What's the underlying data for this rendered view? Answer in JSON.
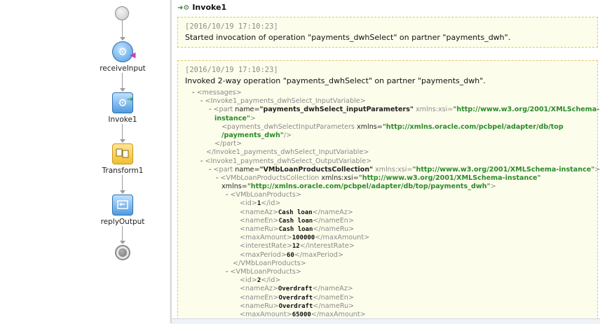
{
  "flow": {
    "nodes": [
      {
        "id": "start",
        "label": ""
      },
      {
        "id": "receive",
        "label": "receiveInput"
      },
      {
        "id": "invoke",
        "label": "Invoke1"
      },
      {
        "id": "transform",
        "label": "Transform1"
      },
      {
        "id": "reply",
        "label": "replyOutput"
      },
      {
        "id": "end",
        "label": ""
      }
    ]
  },
  "log": {
    "title": "Invoke1",
    "entry1": {
      "timestamp": "[2016/10/19 17:10:23]",
      "message": "Started invocation of operation \"payments_dwhSelect\" on partner \"payments_dwh\"."
    },
    "entry2": {
      "timestamp": "[2016/10/19 17:10:23]",
      "message": "Invoked 2-way operation \"payments_dwhSelect\" on partner \"payments_dwh\".",
      "xml": {
        "l1": "<messages>",
        "l2": "<Invoke1_payments_dwhSelect_InputVariable>",
        "l3_tag": "<part ",
        "l3_name_attr": "name=",
        "l3_name_val": "\"payments_dwhSelect_inputParameters\"",
        "l3_xmlns_attr": " xmlns:xsi=",
        "l3_xmlns_val": "\"http://www.w3.org/2001/XMLSchema-",
        "l4_val": "instance\"",
        "l4_close": ">",
        "l5_tag": "<payments_dwhSelectInputParameters ",
        "l5_attr": "xmlns=",
        "l5_val": "\"http://xmlns.oracle.com/pcbpel/adapter/db/top",
        "l6_val": "/payments_dwh\"",
        "l6_close": "/>",
        "l7": "</part>",
        "l8": "</Invoke1_payments_dwhSelect_InputVariable>",
        "l9": "<Invoke1_payments_dwhSelect_OutputVariable>",
        "l10_tag": "<part ",
        "l10_name_attr": "name=",
        "l10_name_val": "\"VMbLoanProductsCollection\"",
        "l10_xmlns_attr": " xmlns:xsi=",
        "l10_xmlns_val": "\"http://www.w3.org/2001/XMLSchema-instance\"",
        "l10_close": ">",
        "l11_tag": "<VMbLoanProductsCollection ",
        "l11_attr": "xmlns:xsi=",
        "l11_val": "\"http://www.w3.org/2001/XMLSchema-instance\"",
        "l12_attr": "xmlns=",
        "l12_val": "\"http://xmlns.oracle.com/pcbpel/adapter/db/top/payments_dwh\"",
        "l12_close": ">",
        "products": [
          {
            "open": "<VMbLoanProducts>",
            "id_o": "<id>",
            "id": "1",
            "id_c": "</id>",
            "az_o": "<nameAz>",
            "az": "Cash loan",
            "az_c": "</nameAz>",
            "en_o": "<nameEn>",
            "en": "Cash loan",
            "en_c": "</nameEn>",
            "ru_o": "<nameRu>",
            "ru": "Cash loan",
            "ru_c": "</nameRu>",
            "ma_o": "<maxAmount>",
            "ma": "100000",
            "ma_c": "</maxAmount>",
            "ir_o": "<interestRate>",
            "ir": "12",
            "ir_c": "</interestRate>",
            "mp_o": "<maxPeriod>",
            "mp": "60",
            "mp_c": "</maxPeriod>",
            "close": "</VMbLoanProducts>"
          },
          {
            "open": "<VMbLoanProducts>",
            "id_o": "<id>",
            "id": "2",
            "id_c": "</id>",
            "az_o": "<nameAz>",
            "az": "Overdraft",
            "az_c": "</nameAz>",
            "en_o": "<nameEn>",
            "en": "Overdraft",
            "en_c": "</nameEn>",
            "ru_o": "<nameRu>",
            "ru": "Overdraft",
            "ru_c": "</nameRu>",
            "ma_o": "<maxAmount>",
            "ma": "65000",
            "ma_c": "</maxAmount>"
          }
        ],
        "minus": "-"
      }
    }
  }
}
